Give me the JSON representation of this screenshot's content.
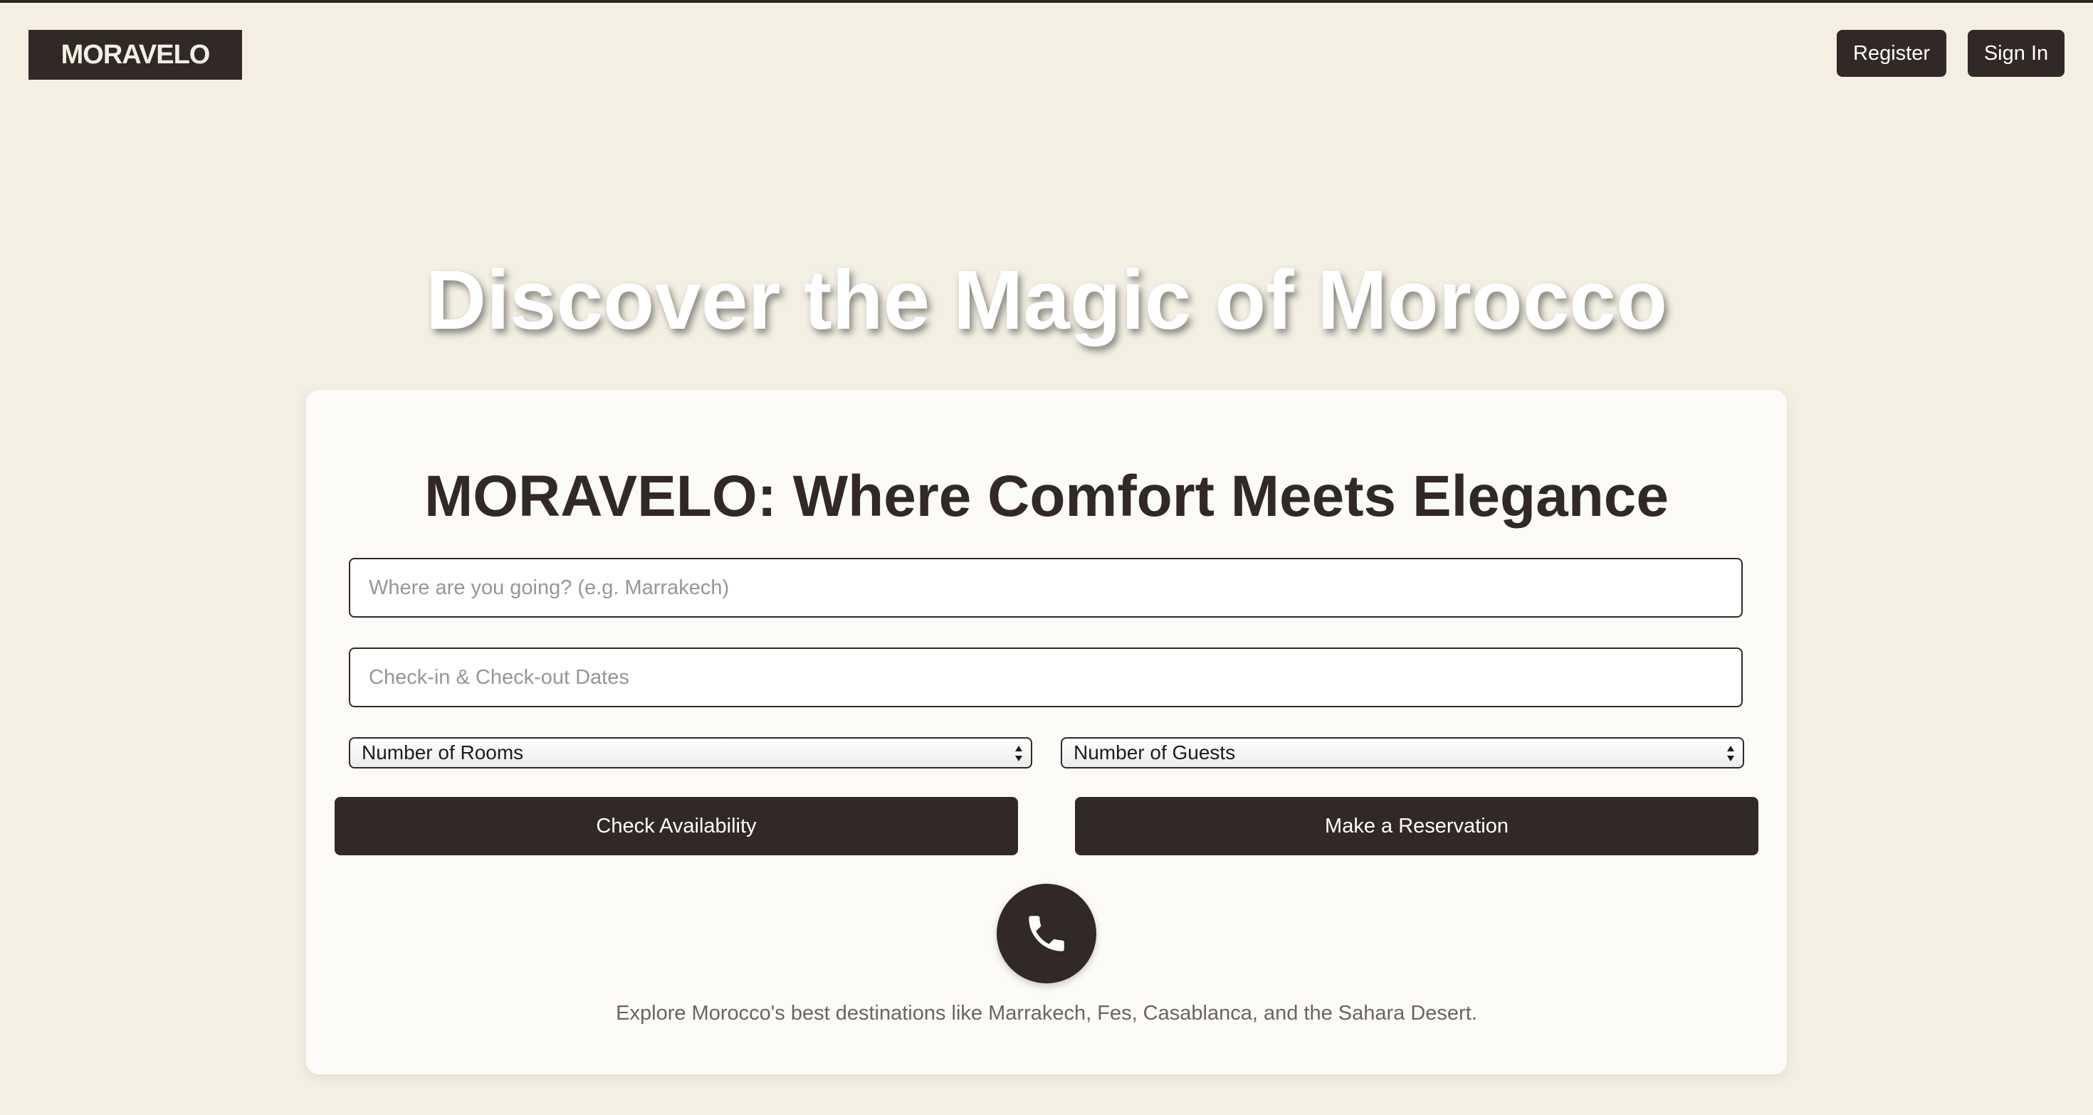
{
  "header": {
    "logo_text": "MORAVELO",
    "register_label": "Register",
    "signin_label": "Sign In"
  },
  "hero": {
    "title": "Discover the Magic of Morocco"
  },
  "booking": {
    "title": "MORAVELO: Where Comfort Meets Elegance",
    "destination_placeholder": "Where are you going? (e.g. Marrakech)",
    "destination_value": "",
    "dates_placeholder": "Check-in & Check-out Dates",
    "dates_value": "",
    "rooms_selected": "Number of Rooms",
    "guests_selected": "Number of Guests",
    "check_label": "Check Availability",
    "reserve_label": "Make a Reservation",
    "phone_icon": "phone-icon",
    "note": "Explore Morocco's best destinations like Marrakech, Fes, Casablanca, and the Sahara Desert."
  },
  "colors": {
    "background": "#f3efe2",
    "primary": "#322826",
    "card": "#fcfbf7",
    "hero_text": "#ffffff"
  }
}
